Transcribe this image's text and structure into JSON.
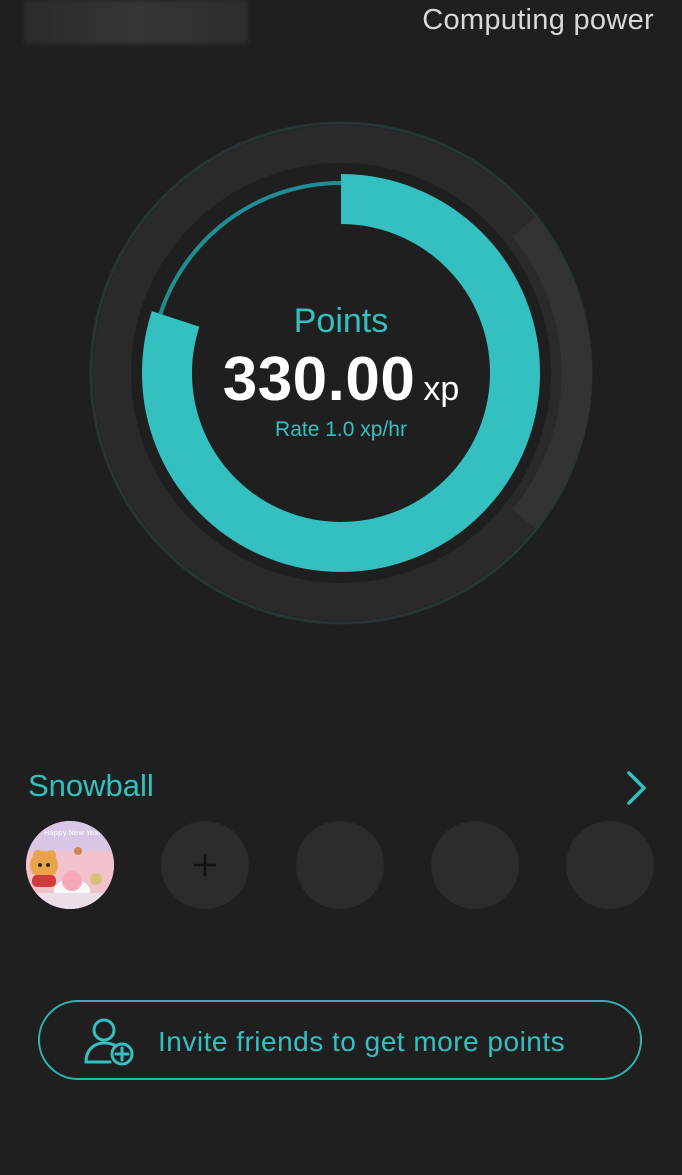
{
  "header": {
    "link_label": "Computing power"
  },
  "gauge": {
    "label": "Points",
    "value": "330.00",
    "unit": "xp",
    "rate": "Rate 1.0 xp/hr",
    "progress_fraction": 0.8,
    "accent_color": "#34c0c1"
  },
  "snowball": {
    "title": "Snowball",
    "avatar_banner": "Happy New Year",
    "slots": [
      {
        "kind": "avatar"
      },
      {
        "kind": "add"
      },
      {
        "kind": "empty"
      },
      {
        "kind": "empty"
      },
      {
        "kind": "empty"
      }
    ]
  },
  "invite": {
    "label": "Invite friends to get more points",
    "icon": "add-user-icon"
  }
}
